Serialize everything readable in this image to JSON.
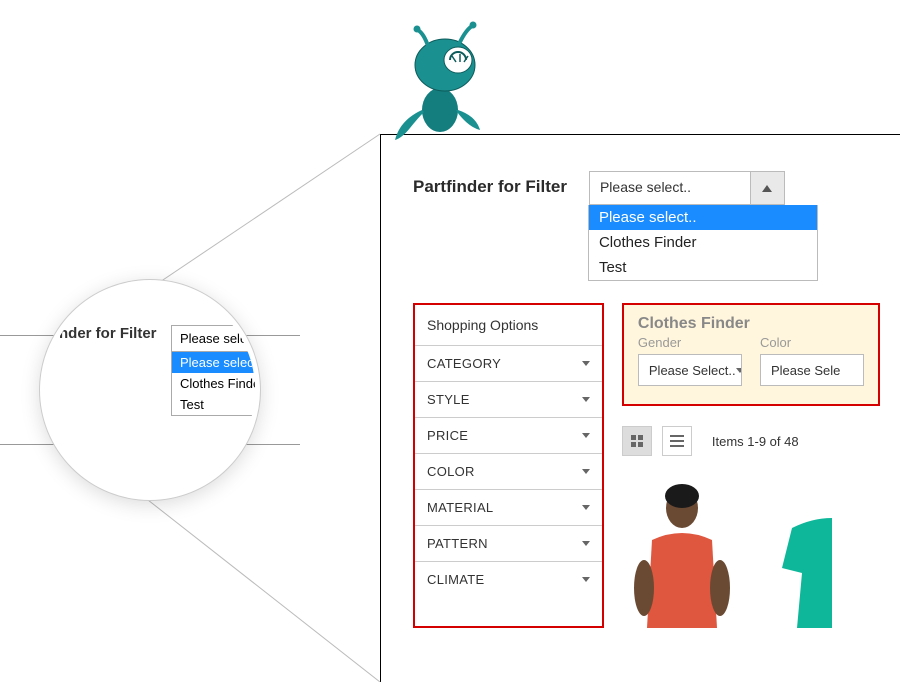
{
  "partfinder": {
    "label": "Partfinder for Filter",
    "selected": "Please select..",
    "options": [
      "Please select..",
      "Clothes Finder",
      "Test"
    ]
  },
  "sidebar": {
    "heading": "Shopping Options",
    "items": [
      "CATEGORY",
      "STYLE",
      "PRICE",
      "COLOR",
      "MATERIAL",
      "PATTERN",
      "CLIMATE"
    ]
  },
  "finder": {
    "title": "Clothes Finder",
    "fields": [
      {
        "label": "Gender",
        "value": "Please Select.."
      },
      {
        "label": "Color",
        "value": "Please Sele"
      }
    ]
  },
  "toolbar": {
    "count": "Items 1-9 of 48"
  },
  "lens": {
    "label": "rtfinder for Filter",
    "selected": "Please select..",
    "options": [
      "Please select..",
      "Clothes Finder",
      "Test"
    ]
  },
  "colors": {
    "highlight_red": "#d40000",
    "accent_blue": "#1a8cff",
    "mascot_teal": "#1a9090"
  }
}
